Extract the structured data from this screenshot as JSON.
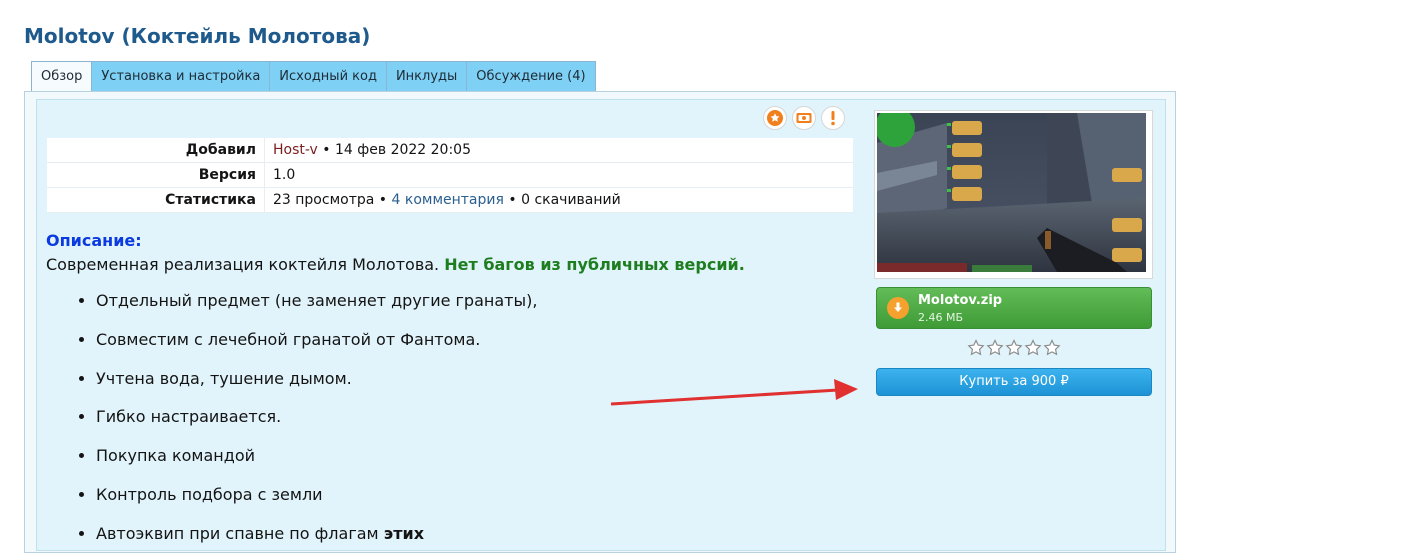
{
  "page": {
    "title": "Molotov (Коктейль Молотова)"
  },
  "tabs": [
    {
      "label": "Обзор"
    },
    {
      "label": "Установка и настройка"
    },
    {
      "label": "Исходный код"
    },
    {
      "label": "Инклуды"
    },
    {
      "label": "Обсуждение (4)"
    }
  ],
  "actions": [
    {
      "icon": "star-icon"
    },
    {
      "icon": "money-icon"
    },
    {
      "icon": "exclamation-icon"
    }
  ],
  "info": {
    "added_label": "Добавил",
    "author": "Host-v",
    "separator": "•",
    "date": "14 фев 2022 20:05",
    "version_label": "Версия",
    "version": "1.0",
    "stats_label": "Статистика",
    "views": "23 просмотра",
    "comments": "4 комментария",
    "downloads": "0 скачиваний"
  },
  "description": {
    "label": "Описание:",
    "text": "Современная реализация коктейля Молотова.",
    "highlight": "Нет багов из публичных версий.",
    "features": [
      "Отдельный предмет (не заменяет другие гранаты),",
      "Совместим с лечебной гранатой от Фантома.",
      "Учтена вода, тушение дымом.",
      "Гибко настраивается.",
      "Покупка командой",
      "Контроль подбора с земли"
    ],
    "partial_feature_prefix": "Автоэквип при спавне по флагам",
    "partial_feature_bold": "этих"
  },
  "download": {
    "filename": "Molotov.zip",
    "size": "2.46 МБ",
    "icon": "download-arrow-icon"
  },
  "rating": {
    "stars_total": 5,
    "stars_filled": 0
  },
  "buy_button": {
    "label": "Купить за 900 ₽"
  },
  "colors": {
    "title": "#1f5a8c",
    "tab_bg": "#7ed0f4",
    "panel_bg": "#e1f4fb",
    "download_bg": "#4caf50",
    "buy_bg": "#29a3e3",
    "annotation_arrow": "#e03030"
  }
}
